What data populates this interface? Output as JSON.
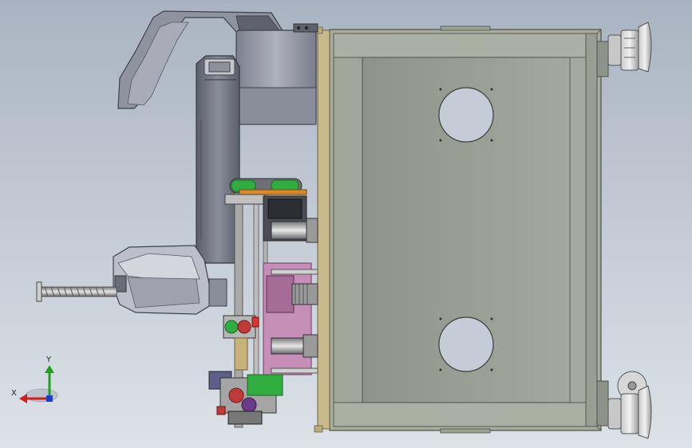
{
  "viewport": {
    "background_top": "#a9b4c2",
    "background_bottom": "#dde2e8"
  },
  "triad": {
    "x_label": "X",
    "y_label": "Y",
    "x_color": "#d21e1e",
    "y_color": "#1ea01e",
    "z_color": "#1e3cd2"
  },
  "colors": {
    "frame": "#a7ad9f",
    "frame_dark": "#7d8278",
    "panel": "#949a90",
    "wood": "#c8b98a",
    "robot": "#9ea1ae",
    "robot_dark": "#6c6f7c",
    "belt_green": "#2fae3f",
    "pink_block": "#c58fb8",
    "orange": "#d88a2a"
  }
}
